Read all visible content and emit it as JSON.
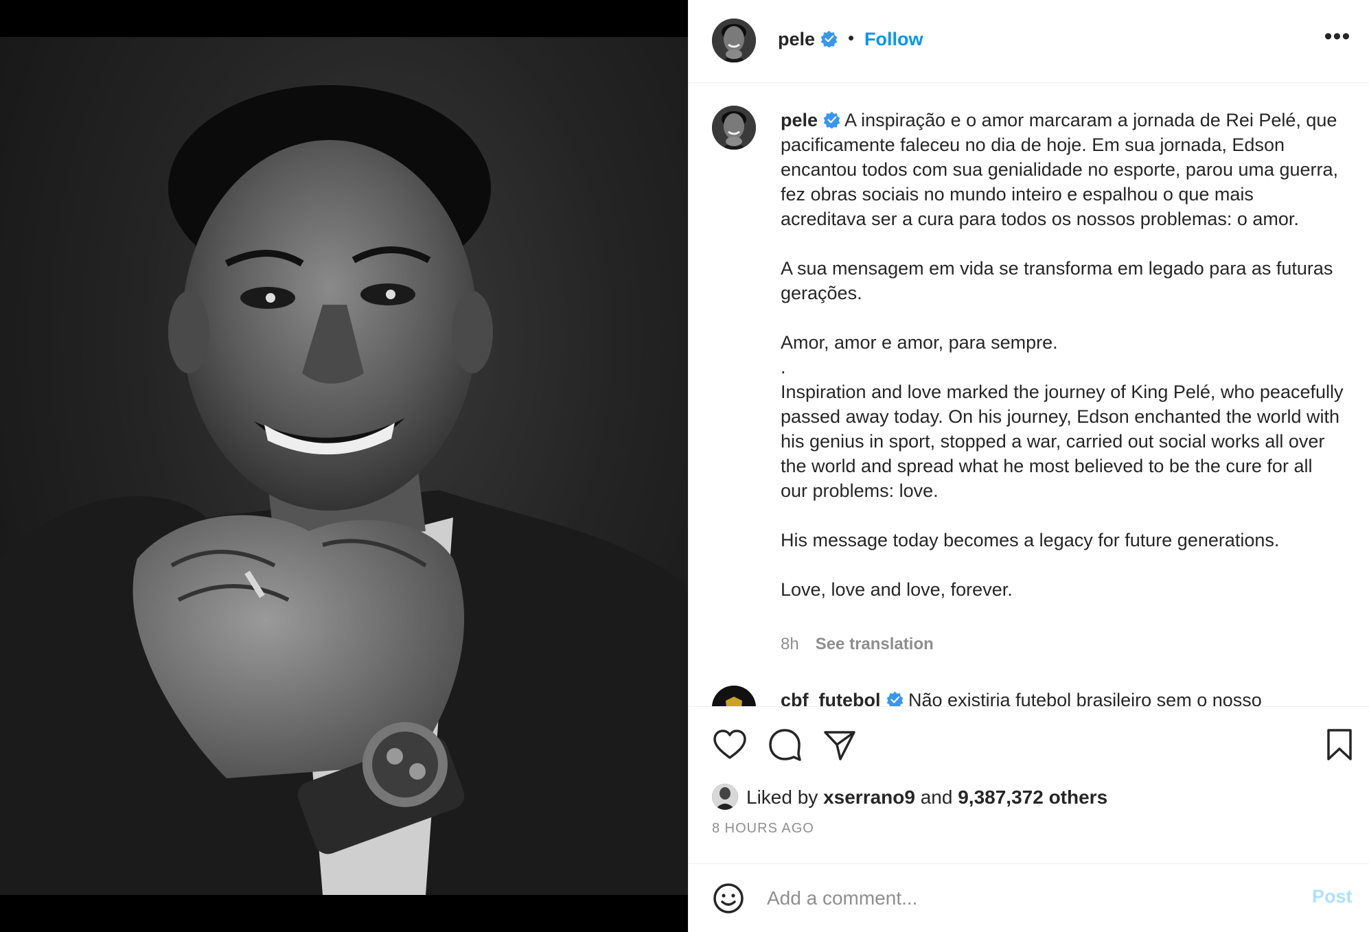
{
  "post": {
    "username": "pele",
    "follow_label": "Follow",
    "separator": "•",
    "more_label": "•••",
    "caption_username": "pele",
    "caption": {
      "pt_1": "A inspiração e o amor marcaram a jornada de Rei Pelé, que pacificamente faleceu no dia de hoje. Em sua jornada, Edson encantou todos com sua genialidade no esporte, parou uma guerra, fez obras sociais no mundo inteiro e espalhou o que mais acreditava ser a cura para todos os nossos problemas: o amor.",
      "pt_2": "A sua mensagem em vida se transforma em legado para as futuras gerações.",
      "pt_3": "Amor, amor e amor, para sempre.",
      "divider": ".",
      "en_1": "Inspiration and love marked the journey of King Pelé, who peacefully passed away today. On his journey, Edson enchanted the world with his genius in sport, stopped a war, carried out social works all over the world and spread what he most believed to be the cure for all our problems: love.",
      "en_2": "His message today becomes a legacy for future generations.",
      "en_3": "Love, love and love, forever."
    },
    "caption_time": "8h",
    "see_translation": "See translation"
  },
  "next_comment": {
    "username": "cbf_futebol",
    "text": "Não existiria futebol brasileiro sem o nosso"
  },
  "likes": {
    "prefix": "Liked by",
    "user": "xserrano9",
    "conj": "and",
    "others": "9,387,372 others"
  },
  "time_ago": "8 HOURS AGO",
  "comment_box": {
    "placeholder": "Add a comment...",
    "post_label": "Post"
  },
  "icons": {
    "verified": "verified-badge-icon",
    "like": "heart-icon",
    "comment": "comment-bubble-icon",
    "share": "paper-plane-icon",
    "save": "bookmark-icon",
    "emoji": "smiley-icon",
    "more": "more-options-icon"
  },
  "colors": {
    "accent": "#0095f6",
    "verified": "#3897f0",
    "post_disabled": "#b2dffc",
    "muted": "#8e8e8e",
    "text": "#262626"
  }
}
